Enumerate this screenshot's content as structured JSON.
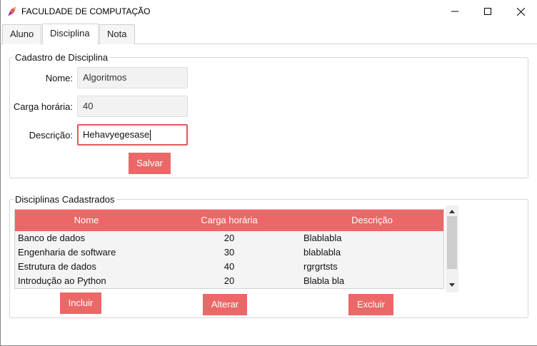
{
  "window": {
    "title": "FACULDADE DE COMPUTAÇÃO",
    "icon": "feather-app-icon",
    "controls": [
      "minimize-icon",
      "maximize-icon",
      "close-icon"
    ]
  },
  "tabs": [
    {
      "label": "Aluno",
      "active": false
    },
    {
      "label": "Disciplina",
      "active": true
    },
    {
      "label": "Nota",
      "active": false
    }
  ],
  "cadastro": {
    "title": "Cadastro de Disciplina",
    "nome_label": "Nome:",
    "nome_value": "Algoritmos",
    "carga_label": "Carga horária:",
    "carga_value": "40",
    "descricao_label": "Descrição:",
    "descricao_value": "Hehavyegesase",
    "save_label": "Salvar"
  },
  "cadastrados": {
    "title": "Disciplinas Cadastrados",
    "columns": [
      "Nome",
      "Carga horária",
      "Descrição"
    ],
    "rows": [
      [
        "Banco de dados",
        "20",
        "Blablabla"
      ],
      [
        "Engenharia de software",
        "30",
        "blablabla"
      ],
      [
        "Estrutura de dados",
        "40",
        "rgrgrtsts"
      ],
      [
        "Introdução ao Python",
        "20",
        "Blabla bla"
      ]
    ],
    "incluir_label": "Incluir",
    "alterar_label": "Alterar",
    "excluir_label": "Excluir"
  },
  "colors": {
    "accent": "#ec6767",
    "focus_border": "#e05a5a"
  }
}
